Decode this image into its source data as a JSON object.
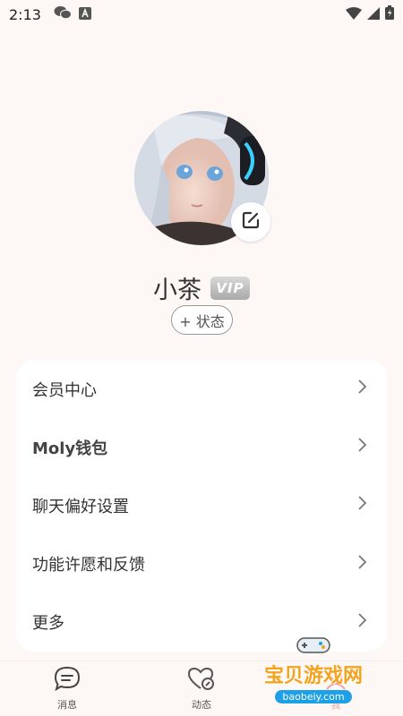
{
  "status_bar": {
    "time": "2:13"
  },
  "profile": {
    "name": "小茶",
    "vip_badge": "VIP",
    "status_button": "+ 状态"
  },
  "menu": {
    "items": [
      {
        "label": "会员中心"
      },
      {
        "label": "Moly钱包"
      },
      {
        "label": "聊天偏好设置"
      },
      {
        "label": "功能许愿和反馈"
      },
      {
        "label": "更多"
      }
    ]
  },
  "tabs": [
    {
      "label": "消息",
      "icon": "chat-icon"
    },
    {
      "label": "动态",
      "icon": "heart-icon"
    },
    {
      "label": "我",
      "icon": "profile-icon"
    }
  ],
  "watermark": {
    "text": "宝贝游戏网",
    "url": "baobeiy.com"
  },
  "colors": {
    "background": "#fdf7f6",
    "card": "#ffffff",
    "accent_orange": "#f5a21c"
  }
}
